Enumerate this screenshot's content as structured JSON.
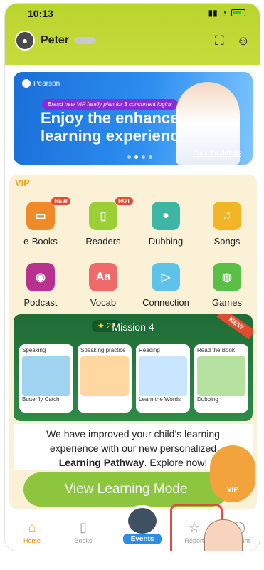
{
  "status": {
    "time": "10:13"
  },
  "user": {
    "name": "Peter"
  },
  "banner": {
    "brand": "Pearson",
    "pill": "Brand new VIP family plan for 3 concurrent logins",
    "headline": "Enjoy the enhanced learning experience",
    "cta": "Click for details"
  },
  "vip": {
    "label": "VIP",
    "features": [
      {
        "label": "e-Books",
        "icon": "ebook-icon",
        "color": "#f08a28",
        "badge": "NEW"
      },
      {
        "label": "Readers",
        "icon": "reader-icon",
        "color": "#9bcf36",
        "badge": "HOT"
      },
      {
        "label": "Dubbing",
        "icon": "microphone-icon",
        "color": "#3db6a6"
      },
      {
        "label": "Songs",
        "icon": "music-icon",
        "color": "#f2b526"
      },
      {
        "label": "Podcast",
        "icon": "radio-icon",
        "color": "#b8318f"
      },
      {
        "label": "Vocab",
        "icon": "vocab-icon",
        "color": "#f06a6a"
      },
      {
        "label": "Connection",
        "icon": "play-icon",
        "color": "#5fc2e8"
      },
      {
        "label": "Games",
        "icon": "gamepad-icon",
        "color": "#5abf45"
      }
    ]
  },
  "mission": {
    "title": "Mission 4",
    "stars": "22",
    "new_tag": "NEW",
    "cards": [
      {
        "title": "Speaking",
        "sub": "Butterfly Catch"
      },
      {
        "title": "Speaking practice",
        "sub": ""
      },
      {
        "title": "Reading",
        "sub": "Learn the Words"
      },
      {
        "title": "Read the Book",
        "sub": "Dubbing"
      }
    ]
  },
  "improve": {
    "line1": "We have improved your child’s learning",
    "line2_pre": "experience with our new personalized",
    "line3_bold": "Learning Pathway",
    "line3_post": ". Explore now!"
  },
  "mode_button": "View Learning Mode",
  "lion_badge": "VIP",
  "tabs": {
    "home": "Home",
    "books": "Books",
    "events": "Events",
    "report": "Report",
    "account": "Account"
  }
}
